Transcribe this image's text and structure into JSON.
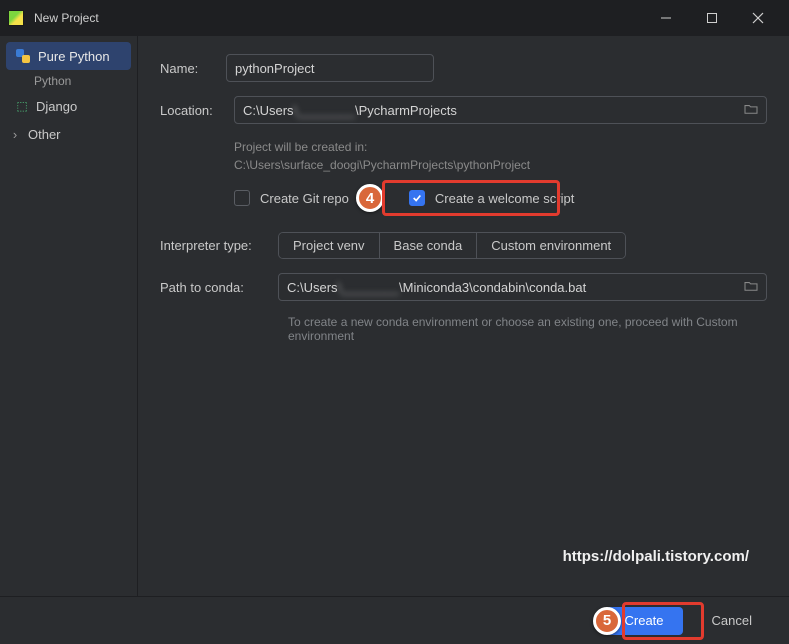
{
  "titlebar": {
    "title": "New Project"
  },
  "sidebar": {
    "items": [
      {
        "label": "Pure Python",
        "sub": "Python"
      },
      {
        "label": "Django"
      },
      {
        "label": "Other"
      }
    ]
  },
  "form": {
    "name_label": "Name:",
    "name_value": "pythonProject",
    "location_label": "Location:",
    "location_prefix": "C:\\Users",
    "location_blurred": "\\________",
    "location_suffix": "\\PycharmProjects",
    "hint_line1": "Project will be created in:",
    "hint_line2": "C:\\Users\\surface_doogi\\PycharmProjects\\pythonProject",
    "git_label": "Create Git repo",
    "welcome_label": "Create a welcome script",
    "interp_label": "Interpreter type:",
    "interp_options": [
      "Project venv",
      "Base conda",
      "Custom environment"
    ],
    "conda_label": "Path to conda:",
    "conda_prefix": "C:\\Users",
    "conda_blurred": "\\________",
    "conda_suffix": "\\Miniconda3\\condabin\\conda.bat",
    "conda_help": "To create a new conda environment or choose an existing one, proceed with Custom environment"
  },
  "footer": {
    "create": "Create",
    "cancel": "Cancel"
  },
  "watermark": "https://dolpali.tistory.com/",
  "callouts": {
    "c4": "4",
    "c5": "5"
  }
}
